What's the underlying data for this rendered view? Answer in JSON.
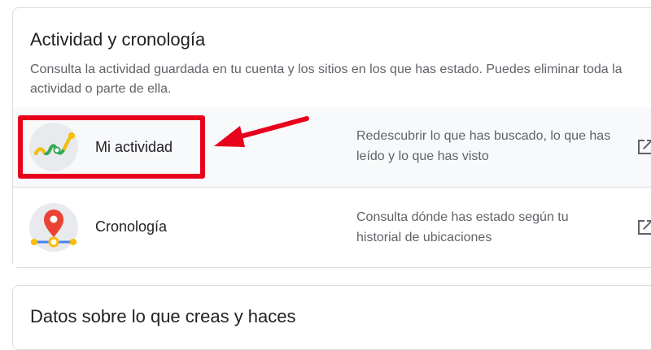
{
  "section_activity": {
    "title": "Actividad y cronología",
    "description": "Consulta la actividad guardada en tu cuenta y los sitios en los que has estado. Puedes eliminar toda la actividad o parte de ella.",
    "items": [
      {
        "label": "Mi actividad",
        "description": "Redescubrir lo que has buscado, lo que has leído y lo que has visto",
        "icon": "my-activity-icon"
      },
      {
        "label": "Cronología",
        "description": "Consulta dónde has estado según tu historial de ubicaciones",
        "icon": "timeline-pin-icon"
      }
    ]
  },
  "section_data": {
    "title": "Datos sobre lo que creas y haces"
  },
  "colors": {
    "highlight": "#e8001c",
    "border": "#dadce0",
    "text_primary": "#202124",
    "text_secondary": "#5f6368"
  }
}
